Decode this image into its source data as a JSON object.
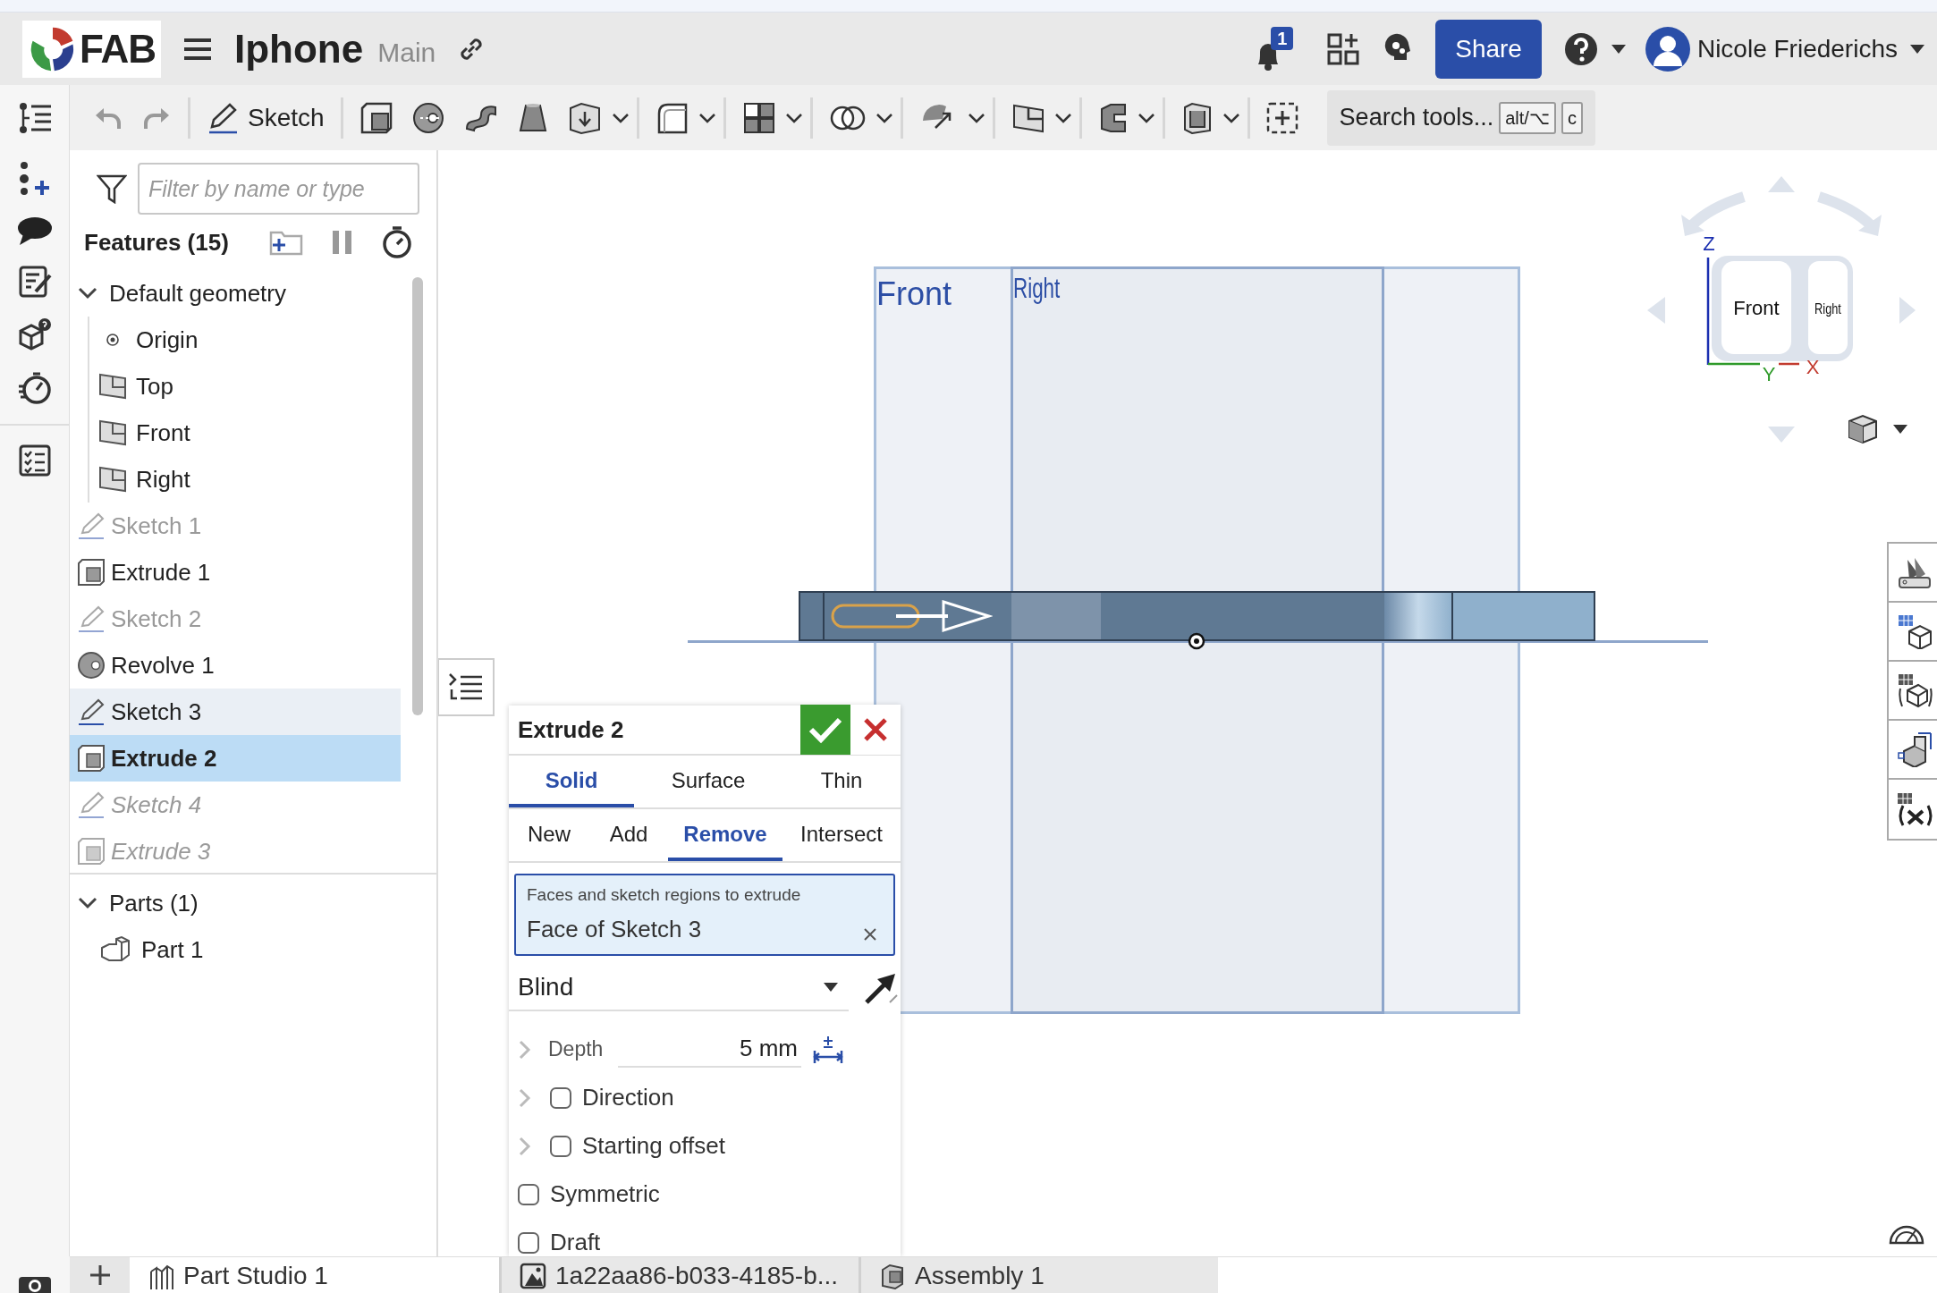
{
  "header": {
    "logo": "FAB",
    "title": "Iphone",
    "branch": "Main",
    "notifications": "1",
    "share": "Share",
    "user": "Nicole Friederichs"
  },
  "toolbar": {
    "sketch": "Sketch",
    "search": "Search tools...",
    "keys": [
      "alt/⌥",
      "c"
    ]
  },
  "feature_panel": {
    "filter_placeholder": "Filter by name or type",
    "title": "Features (15)",
    "default_geometry": {
      "label": "Default geometry",
      "expanded": true,
      "children": [
        {
          "label": "Origin",
          "kind": "origin"
        },
        {
          "label": "Top",
          "kind": "plane"
        },
        {
          "label": "Front",
          "kind": "plane"
        },
        {
          "label": "Right",
          "kind": "plane"
        }
      ]
    },
    "features": [
      {
        "label": "Sketch 1",
        "kind": "sketch",
        "selected": false,
        "highlighted": false,
        "hidden": true,
        "rolled_back": false
      },
      {
        "label": "Extrude 1",
        "kind": "extrude",
        "selected": false,
        "highlighted": false,
        "hidden": false,
        "rolled_back": false
      },
      {
        "label": "Sketch 2",
        "kind": "sketch",
        "selected": false,
        "highlighted": false,
        "hidden": true,
        "rolled_back": false
      },
      {
        "label": "Revolve 1",
        "kind": "revolve",
        "selected": false,
        "highlighted": false,
        "hidden": false,
        "rolled_back": false
      },
      {
        "label": "Sketch 3",
        "kind": "sketch",
        "selected": false,
        "highlighted": true,
        "hidden": false,
        "rolled_back": false
      },
      {
        "label": "Extrude 2",
        "kind": "extrude",
        "selected": true,
        "highlighted": false,
        "hidden": false,
        "rolled_back": false
      },
      {
        "label": "Sketch 4",
        "kind": "sketch",
        "selected": false,
        "highlighted": false,
        "hidden": false,
        "rolled_back": true
      },
      {
        "label": "Extrude 3",
        "kind": "extrude",
        "selected": false,
        "highlighted": false,
        "hidden": false,
        "rolled_back": true
      }
    ],
    "parts": {
      "label": "Parts (1)",
      "expanded": true,
      "children": [
        {
          "label": "Part 1"
        }
      ]
    }
  },
  "dialog": {
    "title": "Extrude 2",
    "body_types": [
      {
        "label": "Solid",
        "selected": true
      },
      {
        "label": "Surface",
        "selected": false
      },
      {
        "label": "Thin",
        "selected": false
      }
    ],
    "operations": [
      {
        "label": "New",
        "selected": false
      },
      {
        "label": "Add",
        "selected": false
      },
      {
        "label": "Remove",
        "selected": true
      },
      {
        "label": "Intersect",
        "selected": false
      }
    ],
    "selection": {
      "label": "Faces and sketch regions to extrude",
      "value": "Face of Sketch 3"
    },
    "end_type": "Blind",
    "depth": {
      "label": "Depth",
      "value": "5 mm"
    },
    "options": [
      {
        "label": "Direction",
        "kind": "expandable",
        "checked": false
      },
      {
        "label": "Starting offset",
        "kind": "expandable",
        "checked": false
      },
      {
        "label": "Symmetric",
        "kind": "plain",
        "checked": false
      },
      {
        "label": "Draft",
        "kind": "plain",
        "checked": false
      }
    ]
  },
  "viewport": {
    "planes": [
      "Front",
      "Right"
    ],
    "view_cube": {
      "faces": [
        "Front",
        "Right"
      ],
      "axes": [
        "Z",
        "Y",
        "X"
      ]
    }
  },
  "tabs": [
    {
      "label": "Part Studio 1",
      "kind": "partstudio",
      "selected": true
    },
    {
      "label": "1a22aa86-b033-4185-b...",
      "kind": "image",
      "selected": false
    },
    {
      "label": "Assembly 1",
      "kind": "assembly",
      "selected": false
    }
  ]
}
